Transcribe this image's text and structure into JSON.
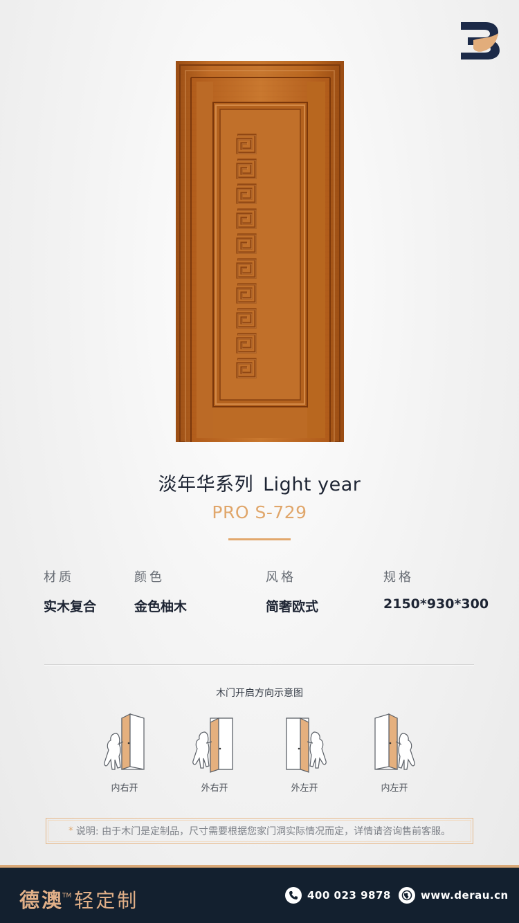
{
  "header": {
    "logo_icon": "brand-logo-icon"
  },
  "product": {
    "series_cn": "淡年华系列",
    "series_en": "Light year",
    "model": "PRO S-729"
  },
  "specs": [
    {
      "label": "材质",
      "value": "实木复合"
    },
    {
      "label": "颜色",
      "value": "金色柚木"
    },
    {
      "label": "风格",
      "value": "简奢欧式"
    },
    {
      "label": "规格",
      "value": "2150*930*300"
    }
  ],
  "diagram": {
    "title": "木门开启方向示意图",
    "items": [
      {
        "caption": "内右开"
      },
      {
        "caption": "外右开"
      },
      {
        "caption": "外左开"
      },
      {
        "caption": "内左开"
      }
    ]
  },
  "note": {
    "star": "*",
    "text": "说明: 由于木门是定制品，尺寸需要根据您家门洞实际情况而定，详情请咨询售前客服。"
  },
  "footer": {
    "brand_cn": "德澳",
    "brand_tm": "TM",
    "brand_sub": "轻定制",
    "phone_icon": "phone-icon",
    "phone": "400 023 9878",
    "web_icon": "globe-icon",
    "website": "www.derau.cn"
  },
  "colors": {
    "accent": "#e0a66a",
    "footer_bg": "#13202f",
    "door_wood": "#b8641f",
    "text_dark": "#1d2433"
  }
}
